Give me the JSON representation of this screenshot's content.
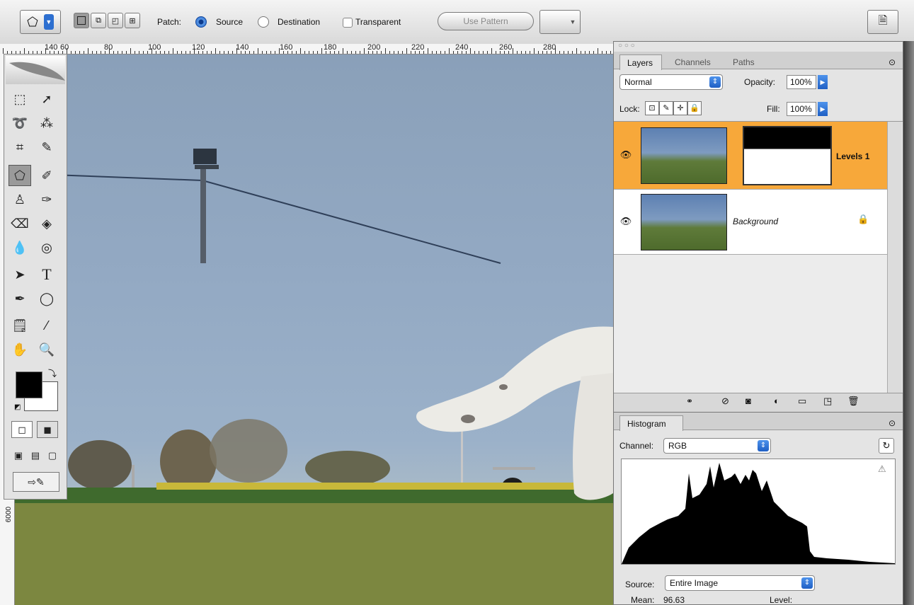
{
  "options_bar": {
    "patch_label": "Patch:",
    "source_label": "Source",
    "destination_label": "Destination",
    "transparent_label": "Transparent",
    "use_pattern_label": "Use Pattern",
    "source_selected": true
  },
  "ruler": {
    "ticks": [
      "140",
      "60",
      "80",
      "100",
      "120",
      "140",
      "160",
      "180",
      "200",
      "220",
      "240",
      "260",
      "280"
    ]
  },
  "layers_panel": {
    "tabs": [
      "Layers",
      "Channels",
      "Paths"
    ],
    "active_tab": "Layers",
    "blend_mode": "Normal",
    "opacity_label": "Opacity:",
    "opacity_value": "100%",
    "lock_label": "Lock:",
    "fill_label": "Fill:",
    "fill_value": "100%",
    "layers": [
      {
        "name": "Levels 1",
        "selected": true
      },
      {
        "name": "Background",
        "selected": false,
        "locked": true
      }
    ]
  },
  "histogram_panel": {
    "tab": "Histogram",
    "channel_label": "Channel:",
    "channel_value": "RGB",
    "source_label": "Source:",
    "source_value": "Entire Image",
    "mean_label": "Mean:",
    "mean_value": "96.63",
    "level_label": "Level:"
  },
  "colors": {
    "selected_layer": "#f7a83a",
    "accent_blue": "#2d6fd0"
  }
}
